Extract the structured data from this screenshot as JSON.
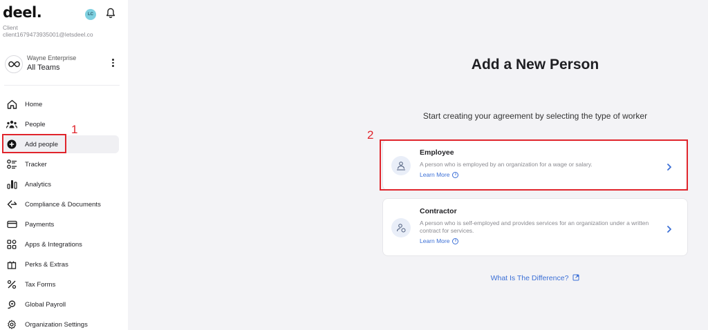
{
  "sidebar": {
    "logo": "deel.",
    "avatar_initials": "LC",
    "role": "Client",
    "email": "client1679473935001@letsdeel.co",
    "org": {
      "company": "Wayne Enterprise",
      "team": "All Teams"
    },
    "items": [
      {
        "label": "Home",
        "icon": "home-icon"
      },
      {
        "label": "People",
        "icon": "people-icon"
      },
      {
        "label": "Add people",
        "icon": "plus-circle-icon",
        "active": true
      },
      {
        "label": "Tracker",
        "icon": "tracker-icon"
      },
      {
        "label": "Analytics",
        "icon": "analytics-icon"
      },
      {
        "label": "Compliance & Documents",
        "icon": "gavel-icon"
      },
      {
        "label": "Payments",
        "icon": "card-icon"
      },
      {
        "label": "Apps & Integrations",
        "icon": "apps-icon"
      },
      {
        "label": "Perks & Extras",
        "icon": "gift-icon"
      },
      {
        "label": "Tax Forms",
        "icon": "percent-icon"
      },
      {
        "label": "Global Payroll",
        "icon": "payroll-icon"
      },
      {
        "label": "Organization Settings",
        "icon": "gear-icon"
      }
    ]
  },
  "annotations": {
    "step1": "1",
    "step2": "2",
    "color": "#e0242b"
  },
  "main": {
    "title": "Add a New Person",
    "subtitle": "Start creating your agreement by selecting the type of worker",
    "options": [
      {
        "title": "Employee",
        "description": "A person who is employed by an organization for a wage or salary.",
        "link": "Learn More"
      },
      {
        "title": "Contractor",
        "description": "A person who is self-employed and provides services for an organization under a written contract for services.",
        "link": "Learn More"
      }
    ],
    "difference_link": "What Is The Difference?"
  },
  "colors": {
    "accent": "#3b6fd6",
    "background": "#f3f3f6",
    "highlight": "#e0242b"
  }
}
